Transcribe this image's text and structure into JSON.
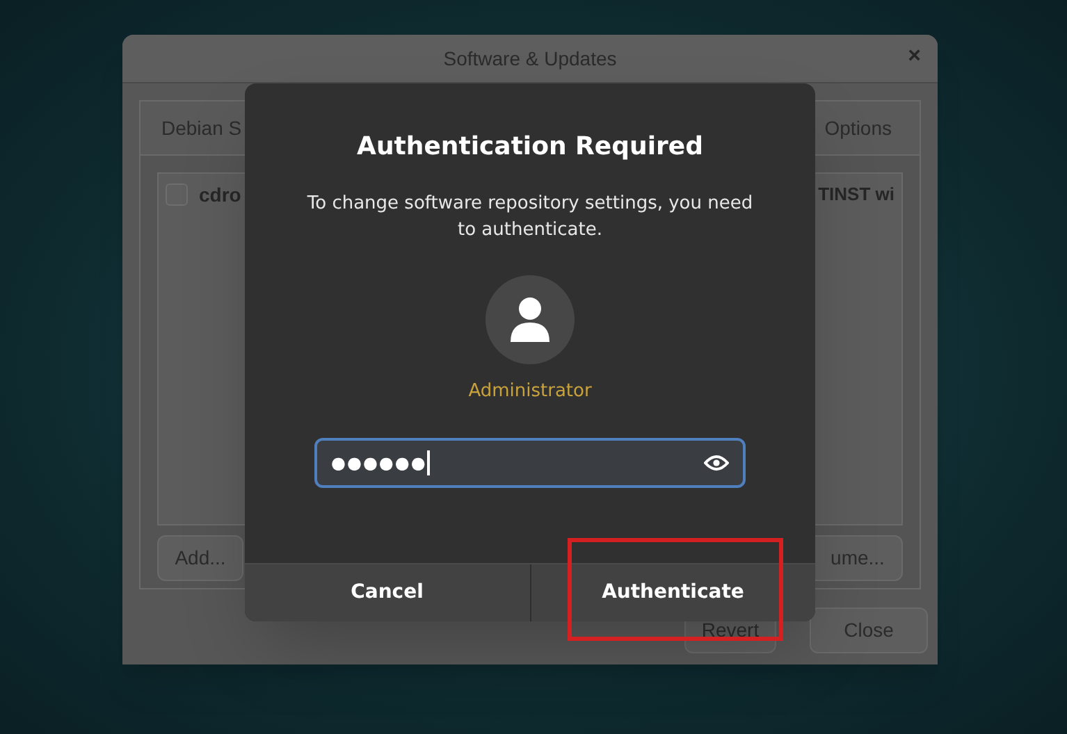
{
  "back_window": {
    "title": "Software & Updates",
    "close": "×",
    "tabs": [
      {
        "label": "Debian S"
      },
      {
        "label": "Options"
      }
    ],
    "rows": [
      {
        "checked": false,
        "label_left": "cdro",
        "label_right": "TINST wi"
      }
    ],
    "buttons": [
      "Add...",
      "ume..."
    ],
    "footer_buttons": [
      "Revert",
      "Close"
    ]
  },
  "dialog": {
    "title": "Authentication Required",
    "message": "To change software repository settings, you need to authenticate.",
    "user": "Administrator",
    "password": {
      "value": "●●●●●●",
      "focused": true
    },
    "buttons": [
      {
        "label": "Cancel"
      },
      {
        "label": "Authenticate"
      }
    ]
  }
}
